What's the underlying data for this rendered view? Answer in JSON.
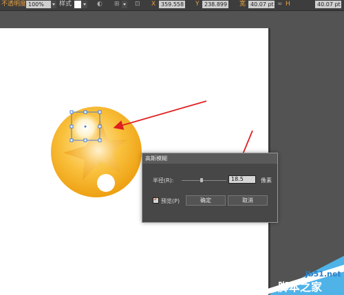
{
  "toolbar": {
    "opacity_label": "不透明度",
    "opacity_value": "100%",
    "style_label": "样式",
    "x_value": "359.558",
    "y_value": "238.899",
    "width_label": "宽",
    "width_value": "40.07 pt",
    "height_value": "40.07 pt"
  },
  "dialog": {
    "title": "高斯模糊",
    "radius_label": "半径(R):",
    "radius_value": "18.5",
    "radius_unit": "像素",
    "preview_label": "预览(P)",
    "preview_checked": true,
    "ok_label": "确定",
    "cancel_label": "取消"
  },
  "colors": {
    "arrow": "#e01f1f",
    "selection": "#4a7bd6",
    "orange": "#f4a41c"
  },
  "watermark": {
    "url": "jb51.net",
    "text": "脚本之家"
  }
}
